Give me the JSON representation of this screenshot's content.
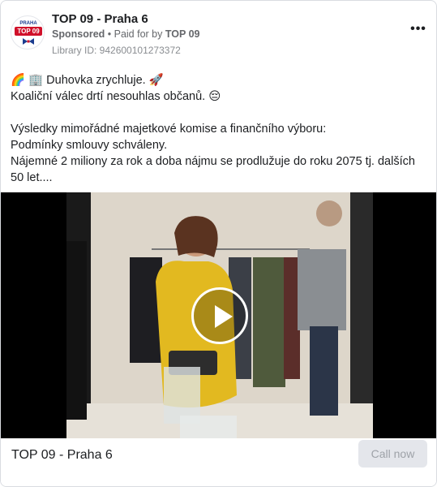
{
  "header": {
    "page_name": "TOP 09 - Praha 6",
    "sponsored_label": "Sponsored",
    "paid_for_prefix": " • Paid for by ",
    "paid_for_name": "TOP 09",
    "library_id": "Library ID: 942600101273372",
    "more_icon": "more-horizontal-icon"
  },
  "avatar": {
    "top_text": "PRAHA",
    "badge_text": "TOP 09"
  },
  "body": {
    "line1": "🌈 🏢 Duhovka zrychluje. 🚀",
    "line2": "Koaliční válec drtí nesouhlas občanů. 😔",
    "line3": "Výsledky mimořádné majetkové komise a finančního výboru:",
    "line4": "Podmínky smlouvy schváleny.",
    "line5": "Nájemné 2 miliony za rok a doba nájmu se prodlužuje do roku 2075 tj. dalších 50 let...."
  },
  "video": {
    "play_icon": "play-icon"
  },
  "footer": {
    "title": "TOP 09 - Praha 6",
    "cta_label": "Call now"
  },
  "colors": {
    "brand_red": "#d0102a",
    "brand_blue": "#1b3c8f",
    "muted_text": "#65676b",
    "button_bg": "#e4e6eb"
  }
}
